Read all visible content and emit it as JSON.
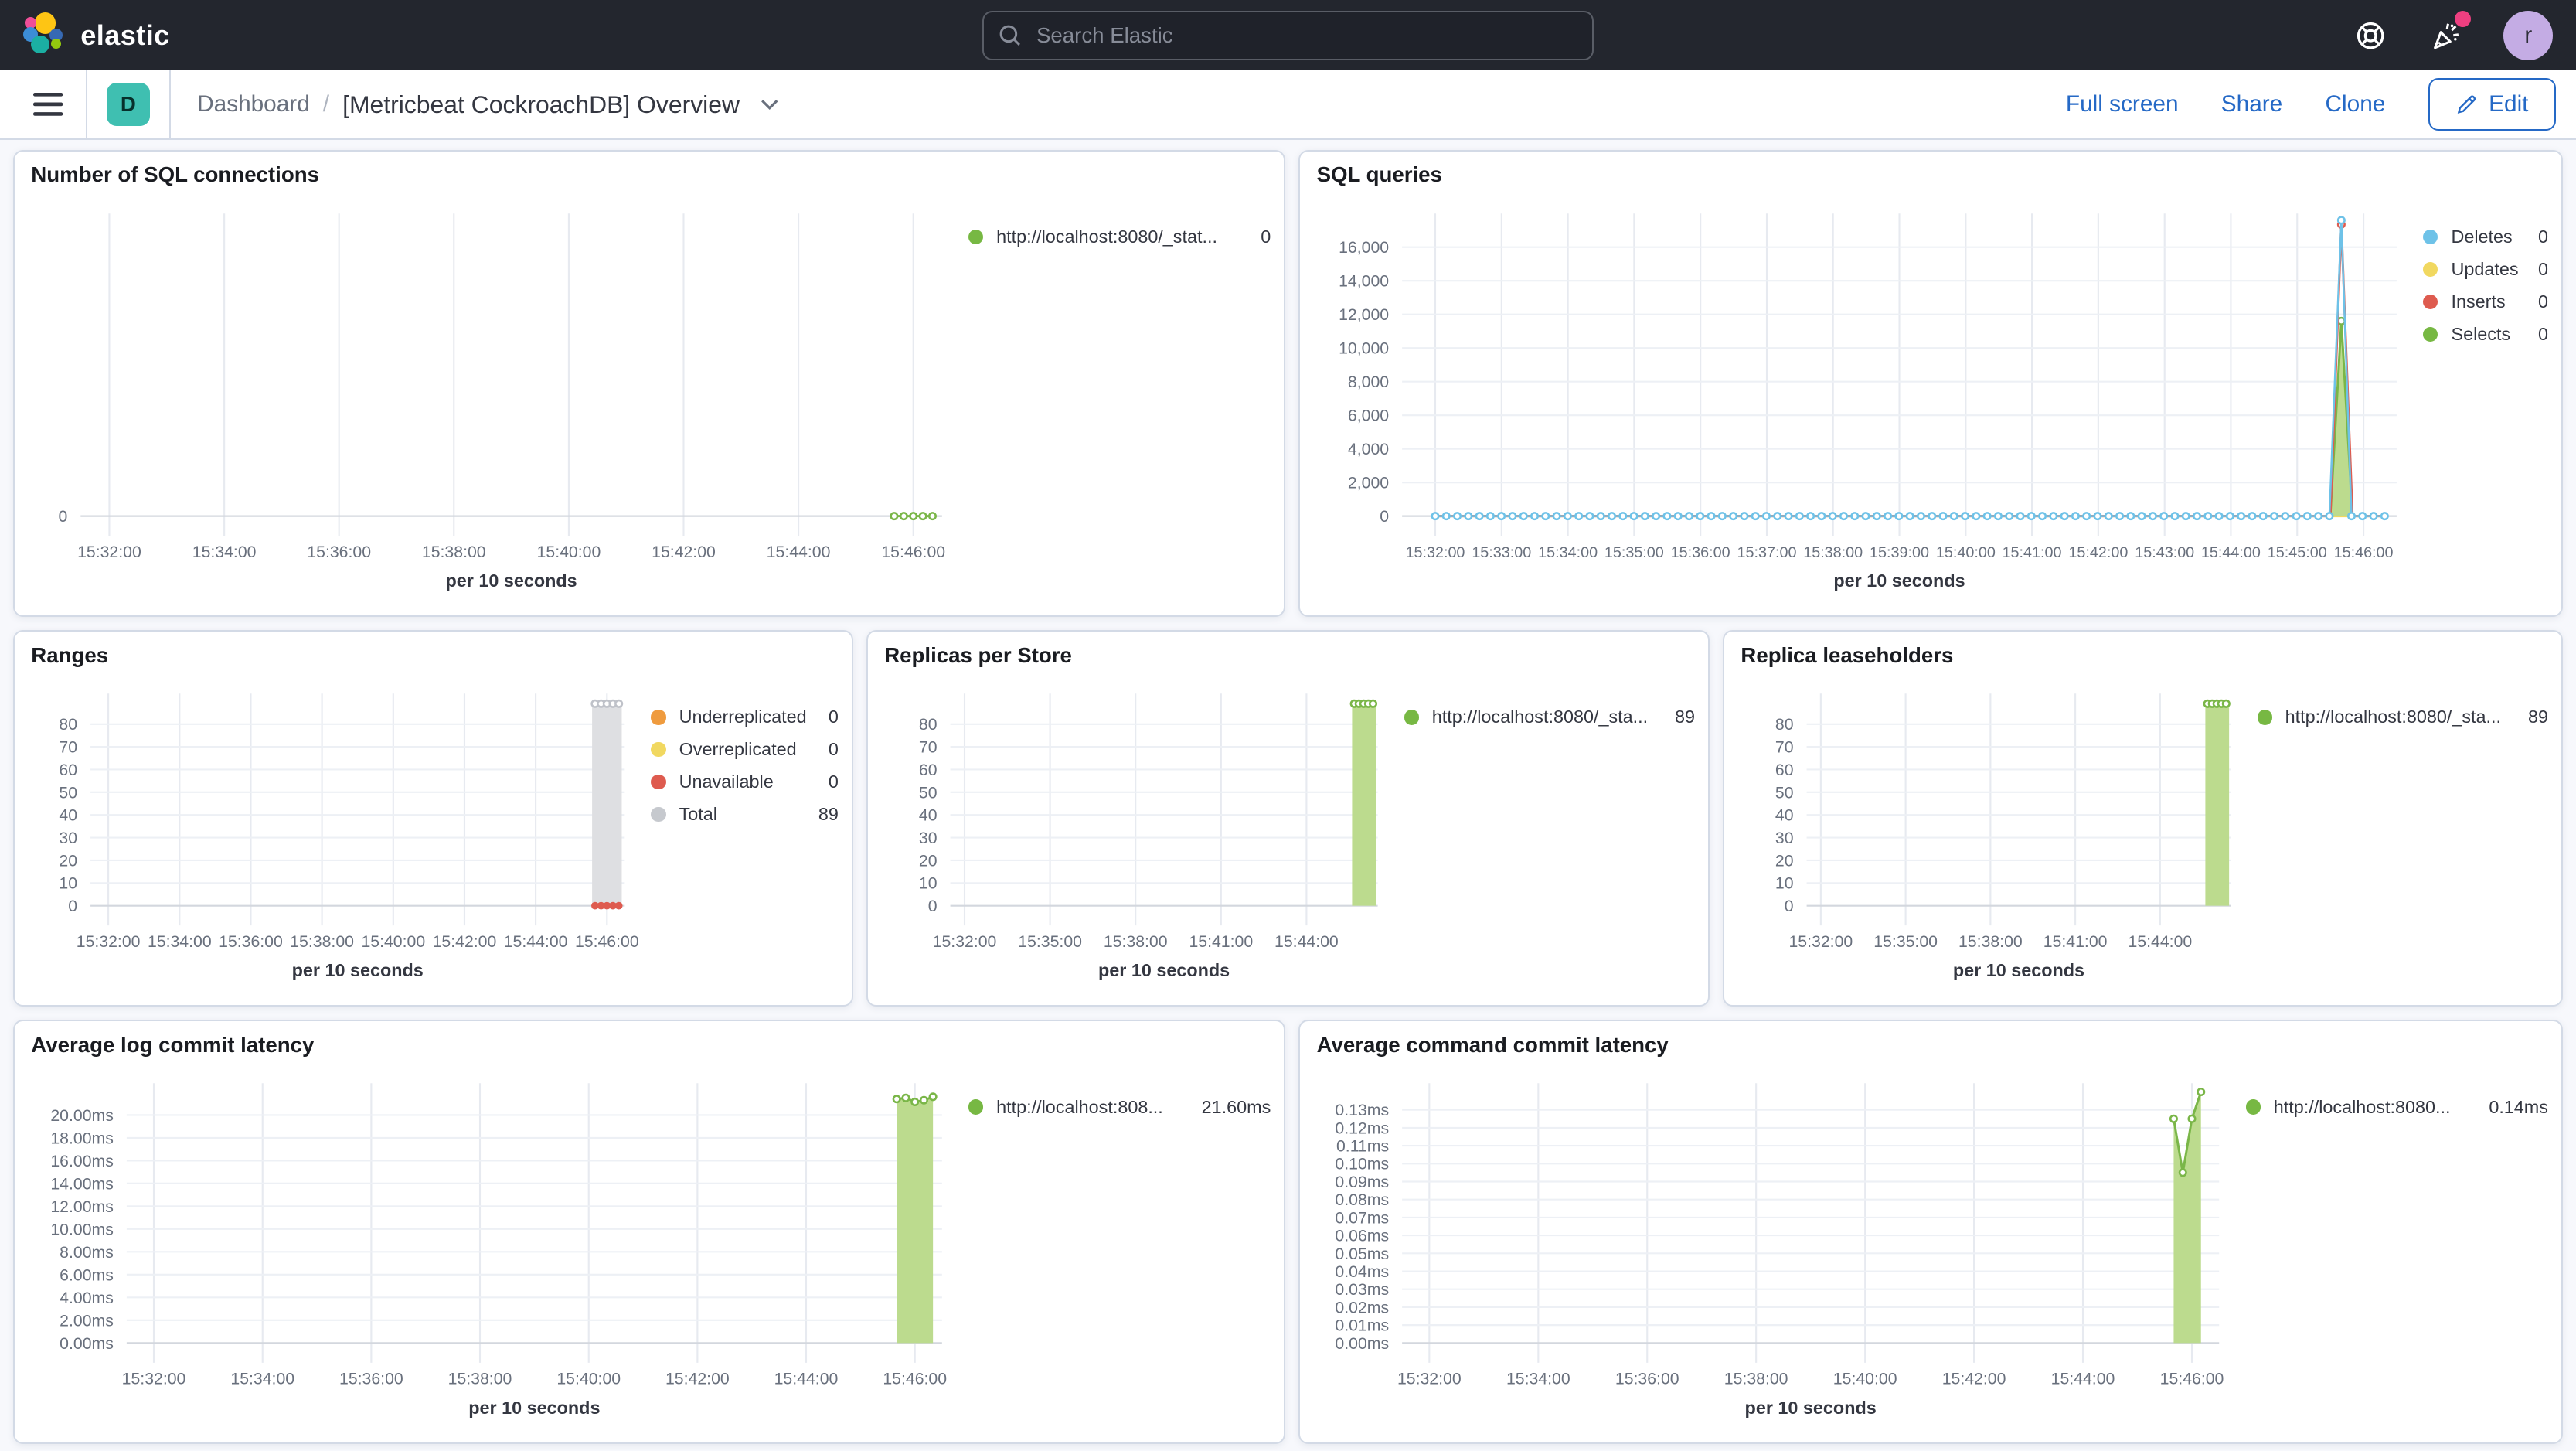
{
  "header": {
    "logo_text": "elastic",
    "search_placeholder": "Search Elastic",
    "avatar_initial": "r",
    "icons": [
      "search-icon",
      "help-icon",
      "news-icon"
    ],
    "notification_color": "#EE3F80"
  },
  "toolbar": {
    "space_badge": "D",
    "breadcrumb": "Dashboard",
    "separator": "/",
    "title": "[Metricbeat CockroachDB] Overview",
    "actions": {
      "full_screen": "Full screen",
      "share": "Share",
      "clone": "Clone",
      "edit": "Edit"
    }
  },
  "panels": [
    {
      "title": "Number of SQL connections",
      "legend": [
        {
          "label": "http://localhost:8080/_stat...",
          "value": "0",
          "color": "#77B843"
        }
      ],
      "chart_data": {
        "type": "line",
        "x_axis": {
          "title": "per 10 seconds",
          "ticks": [
            {
              "frac": 0.0333,
              "label": "15:32:00"
            },
            {
              "frac": 0.1667,
              "label": "15:34:00"
            },
            {
              "frac": 0.3,
              "label": "15:36:00"
            },
            {
              "frac": 0.4333,
              "label": "15:38:00"
            },
            {
              "frac": 0.5667,
              "label": "15:40:00"
            },
            {
              "frac": 0.7,
              "label": "15:42:00"
            },
            {
              "frac": 0.8333,
              "label": "15:44:00"
            },
            {
              "frac": 0.9667,
              "label": "15:46:00"
            }
          ]
        },
        "y_axis": {
          "max": 8,
          "ticks": [
            {
              "value": 0,
              "label": "0"
            }
          ]
        },
        "series": [
          {
            "name": "connections",
            "kind": "line",
            "color": "#7AB648",
            "markers": "open",
            "fracs": [
              0.9444,
              0.9556,
              0.9667,
              0.9778,
              0.9889
            ],
            "values": [
              0,
              0,
              0,
              0,
              0
            ]
          }
        ]
      }
    },
    {
      "title": "SQL queries",
      "legend": [
        {
          "label": "Deletes",
          "value": "0",
          "color": "#6EC2E8"
        },
        {
          "label": "Updates",
          "value": "0",
          "color": "#F1D860"
        },
        {
          "label": "Inserts",
          "value": "0",
          "color": "#DE5B4F"
        },
        {
          "label": "Selects",
          "value": "0",
          "color": "#77B843"
        }
      ],
      "chart_data": {
        "type": "area",
        "x_axis": {
          "title": "per 10 seconds",
          "small": true,
          "ticks": [
            {
              "frac": 0.0333,
              "label": "15:32:00"
            },
            {
              "frac": 0.1,
              "label": "15:33:00"
            },
            {
              "frac": 0.1667,
              "label": "15:34:00"
            },
            {
              "frac": 0.2333,
              "label": "15:35:00"
            },
            {
              "frac": 0.3,
              "label": "15:36:00"
            },
            {
              "frac": 0.3667,
              "label": "15:37:00"
            },
            {
              "frac": 0.4333,
              "label": "15:38:00"
            },
            {
              "frac": 0.5,
              "label": "15:39:00"
            },
            {
              "frac": 0.5667,
              "label": "15:40:00"
            },
            {
              "frac": 0.6333,
              "label": "15:41:00"
            },
            {
              "frac": 0.7,
              "label": "15:42:00"
            },
            {
              "frac": 0.7667,
              "label": "15:43:00"
            },
            {
              "frac": 0.8333,
              "label": "15:44:00"
            },
            {
              "frac": 0.9,
              "label": "15:45:00"
            },
            {
              "frac": 0.9667,
              "label": "15:46:00"
            }
          ]
        },
        "y_axis": {
          "max": 17800,
          "ticks": [
            {
              "value": 0,
              "label": "0"
            },
            {
              "value": 2000,
              "label": "2,000"
            },
            {
              "value": 4000,
              "label": "4,000"
            },
            {
              "value": 6000,
              "label": "6,000"
            },
            {
              "value": 8000,
              "label": "8,000"
            },
            {
              "value": 10000,
              "label": "10,000"
            },
            {
              "value": 12000,
              "label": "12,000"
            },
            {
              "value": 14000,
              "label": "14,000"
            },
            {
              "value": 16000,
              "label": "16,000"
            }
          ]
        },
        "series": [
          {
            "name": "Updates",
            "kind": "line",
            "color": "#F1D860",
            "markers": "none",
            "fracs": [
              0.0333,
              0.9889
            ],
            "values": [
              0,
              0
            ]
          },
          {
            "name": "Selects",
            "kind": "area",
            "color": "#7AB648",
            "fill": "#BCDB8E",
            "markers": "open",
            "markers_nonzero_only": true,
            "fracs": [
              0.9333,
              0.9444,
              0.9556
            ],
            "values": [
              0,
              11600,
              0
            ]
          },
          {
            "name": "Inserts",
            "kind": "line",
            "color": "#DE5B4F",
            "markers": "open",
            "markers_nonzero_only": true,
            "fracs": [
              0.0333,
              0.9333,
              0.9444,
              0.9556,
              0.9889
            ],
            "values": [
              0,
              0,
              17350,
              0,
              0
            ]
          },
          {
            "name": "Deletes",
            "kind": "line",
            "color": "#6EC2E8",
            "width": 1.2,
            "markers": "open",
            "baseline_zero": {
              "start": 0.0333,
              "end": 0.9889,
              "step": 0.0111
            },
            "spike": {
              "frac": 0.9444,
              "value": 17600
            }
          }
        ]
      }
    },
    {
      "title": "Ranges",
      "legend": [
        {
          "label": "Underreplicated",
          "value": "0",
          "color": "#EF9B3E"
        },
        {
          "label": "Overreplicated",
          "value": "0",
          "color": "#F1D860"
        },
        {
          "label": "Unavailable",
          "value": "0",
          "color": "#DE5B4F"
        },
        {
          "label": "Total",
          "value": "89",
          "color": "#C6C9CE"
        }
      ],
      "chart_data": {
        "type": "area",
        "x_axis": {
          "title": "per 10 seconds",
          "ticks": [
            {
              "frac": 0.0333,
              "label": "15:32:00"
            },
            {
              "frac": 0.1667,
              "label": "15:34:00"
            },
            {
              "frac": 0.3,
              "label": "15:36:00"
            },
            {
              "frac": 0.4333,
              "label": "15:38:00"
            },
            {
              "frac": 0.5667,
              "label": "15:40:00"
            },
            {
              "frac": 0.7,
              "label": "15:42:00"
            },
            {
              "frac": 0.8333,
              "label": "15:44:00"
            },
            {
              "frac": 0.9667,
              "label": "15:46:00"
            }
          ]
        },
        "y_axis": {
          "max": 92,
          "ticks": [
            {
              "value": 0,
              "label": "0"
            },
            {
              "value": 10,
              "label": "10"
            },
            {
              "value": 20,
              "label": "20"
            },
            {
              "value": 30,
              "label": "30"
            },
            {
              "value": 40,
              "label": "40"
            },
            {
              "value": 50,
              "label": "50"
            },
            {
              "value": 60,
              "label": "60"
            },
            {
              "value": 70,
              "label": "70"
            },
            {
              "value": 80,
              "label": "80"
            }
          ]
        },
        "series": [
          {
            "name": "Total",
            "kind": "band",
            "x0": 0.9389,
            "x1": 0.9944,
            "value": 89,
            "fill": "#DEDFE2",
            "color": "#BFC2C9",
            "marker_fracs": [
              0.9444,
              0.9556,
              0.9667,
              0.9778,
              0.9889
            ]
          },
          {
            "name": "Unavailable",
            "kind": "dots",
            "color": "#DE5B4F",
            "value": 0,
            "fracs": [
              0.9444,
              0.9556,
              0.9667,
              0.9778,
              0.9889
            ]
          }
        ]
      }
    },
    {
      "title": "Replicas per Store",
      "legend": [
        {
          "label": "http://localhost:8080/_sta...",
          "value": "89",
          "color": "#77B843"
        }
      ],
      "chart_data": {
        "type": "area",
        "x_axis": {
          "title": "per 10 seconds",
          "ticks": [
            {
              "frac": 0.0333,
              "label": "15:32:00"
            },
            {
              "frac": 0.2333,
              "label": "15:35:00"
            },
            {
              "frac": 0.4333,
              "label": "15:38:00"
            },
            {
              "frac": 0.6333,
              "label": "15:41:00"
            },
            {
              "frac": 0.8333,
              "label": "15:44:00"
            }
          ]
        },
        "y_axis": {
          "max": 92,
          "ticks": [
            {
              "value": 0,
              "label": "0"
            },
            {
              "value": 10,
              "label": "10"
            },
            {
              "value": 20,
              "label": "20"
            },
            {
              "value": 30,
              "label": "30"
            },
            {
              "value": 40,
              "label": "40"
            },
            {
              "value": 50,
              "label": "50"
            },
            {
              "value": 60,
              "label": "60"
            },
            {
              "value": 70,
              "label": "70"
            },
            {
              "value": 80,
              "label": "80"
            }
          ]
        },
        "series": [
          {
            "name": "replicas",
            "kind": "band",
            "x0": 0.94,
            "x1": 0.996,
            "value": 89,
            "fill": "#BCDB8E",
            "color": "#7AB648",
            "marker_fracs": [
              0.945,
              0.956,
              0.967,
              0.978,
              0.989
            ]
          }
        ]
      }
    },
    {
      "title": "Replica leaseholders",
      "legend": [
        {
          "label": "http://localhost:8080/_sta...",
          "value": "89",
          "color": "#77B843"
        }
      ],
      "chart_data": {
        "type": "area",
        "x_axis": {
          "title": "per 10 seconds",
          "ticks": [
            {
              "frac": 0.0333,
              "label": "15:32:00"
            },
            {
              "frac": 0.2333,
              "label": "15:35:00"
            },
            {
              "frac": 0.4333,
              "label": "15:38:00"
            },
            {
              "frac": 0.6333,
              "label": "15:41:00"
            },
            {
              "frac": 0.8333,
              "label": "15:44:00"
            }
          ]
        },
        "y_axis": {
          "max": 92,
          "ticks": [
            {
              "value": 0,
              "label": "0"
            },
            {
              "value": 10,
              "label": "10"
            },
            {
              "value": 20,
              "label": "20"
            },
            {
              "value": 30,
              "label": "30"
            },
            {
              "value": 40,
              "label": "40"
            },
            {
              "value": 50,
              "label": "50"
            },
            {
              "value": 60,
              "label": "60"
            },
            {
              "value": 70,
              "label": "70"
            },
            {
              "value": 80,
              "label": "80"
            }
          ]
        },
        "series": [
          {
            "name": "leaseholders",
            "kind": "band",
            "x0": 0.94,
            "x1": 0.996,
            "value": 89,
            "fill": "#BCDB8E",
            "color": "#7AB648",
            "marker_fracs": [
              0.945,
              0.956,
              0.967,
              0.978,
              0.989
            ]
          }
        ]
      }
    },
    {
      "title": "Average log commit latency",
      "legend": [
        {
          "label": "http://localhost:808...",
          "value": "21.60ms",
          "color": "#77B843"
        }
      ],
      "chart_data": {
        "type": "area",
        "x_axis": {
          "title": "per 10 seconds",
          "ticks": [
            {
              "frac": 0.0333,
              "label": "15:32:00"
            },
            {
              "frac": 0.1667,
              "label": "15:34:00"
            },
            {
              "frac": 0.3,
              "label": "15:36:00"
            },
            {
              "frac": 0.4333,
              "label": "15:38:00"
            },
            {
              "frac": 0.5667,
              "label": "15:40:00"
            },
            {
              "frac": 0.7,
              "label": "15:42:00"
            },
            {
              "frac": 0.8333,
              "label": "15:44:00"
            },
            {
              "frac": 0.9667,
              "label": "15:46:00"
            }
          ]
        },
        "y_axis": {
          "max": 22.5,
          "ticks": [
            {
              "value": 0,
              "label": "0.00ms"
            },
            {
              "value": 2,
              "label": "2.00ms"
            },
            {
              "value": 4,
              "label": "4.00ms"
            },
            {
              "value": 6,
              "label": "6.00ms"
            },
            {
              "value": 8,
              "label": "8.00ms"
            },
            {
              "value": 10,
              "label": "10.00ms"
            },
            {
              "value": 12,
              "label": "12.00ms"
            },
            {
              "value": 14,
              "label": "14.00ms"
            },
            {
              "value": 16,
              "label": "16.00ms"
            },
            {
              "value": 18,
              "label": "18.00ms"
            },
            {
              "value": 20,
              "label": "20.00ms"
            }
          ]
        },
        "series": [
          {
            "name": "log-latency",
            "kind": "area",
            "color": "#7AB648",
            "fill": "#BCDB8E",
            "markers": "open",
            "fracs": [
              0.9444,
              0.9556,
              0.9667,
              0.9778,
              0.9889
            ],
            "values": [
              21.4,
              21.5,
              21.15,
              21.3,
              21.6
            ]
          }
        ]
      }
    },
    {
      "title": "Average command commit latency",
      "legend": [
        {
          "label": "http://localhost:8080...",
          "value": "0.14ms",
          "color": "#77B843"
        }
      ],
      "chart_data": {
        "type": "area",
        "x_axis": {
          "title": "per 10 seconds",
          "ticks": [
            {
              "frac": 0.0333,
              "label": "15:32:00"
            },
            {
              "frac": 0.1667,
              "label": "15:34:00"
            },
            {
              "frac": 0.3,
              "label": "15:36:00"
            },
            {
              "frac": 0.4333,
              "label": "15:38:00"
            },
            {
              "frac": 0.5667,
              "label": "15:40:00"
            },
            {
              "frac": 0.7,
              "label": "15:42:00"
            },
            {
              "frac": 0.8333,
              "label": "15:44:00"
            },
            {
              "frac": 0.9667,
              "label": "15:46:00"
            }
          ]
        },
        "y_axis": {
          "max": 0.143,
          "ticks": [
            {
              "value": 0,
              "label": "0.00ms"
            },
            {
              "value": 0.01,
              "label": "0.01ms"
            },
            {
              "value": 0.02,
              "label": "0.02ms"
            },
            {
              "value": 0.03,
              "label": "0.03ms"
            },
            {
              "value": 0.04,
              "label": "0.04ms"
            },
            {
              "value": 0.05,
              "label": "0.05ms"
            },
            {
              "value": 0.06,
              "label": "0.06ms"
            },
            {
              "value": 0.07,
              "label": "0.07ms"
            },
            {
              "value": 0.08,
              "label": "0.08ms"
            },
            {
              "value": 0.09,
              "label": "0.09ms"
            },
            {
              "value": 0.1,
              "label": "0.10ms"
            },
            {
              "value": 0.11,
              "label": "0.11ms"
            },
            {
              "value": 0.12,
              "label": "0.12ms"
            },
            {
              "value": 0.13,
              "label": "0.13ms"
            }
          ]
        },
        "series": [
          {
            "name": "cmd-latency",
            "kind": "area",
            "color": "#7AB648",
            "fill": "#BCDB8E",
            "markers": "open",
            "fracs": [
              0.9444,
              0.9556,
              0.9667,
              0.9778
            ],
            "values": [
              0.125,
              0.095,
              0.125,
              0.14
            ]
          }
        ]
      }
    }
  ]
}
